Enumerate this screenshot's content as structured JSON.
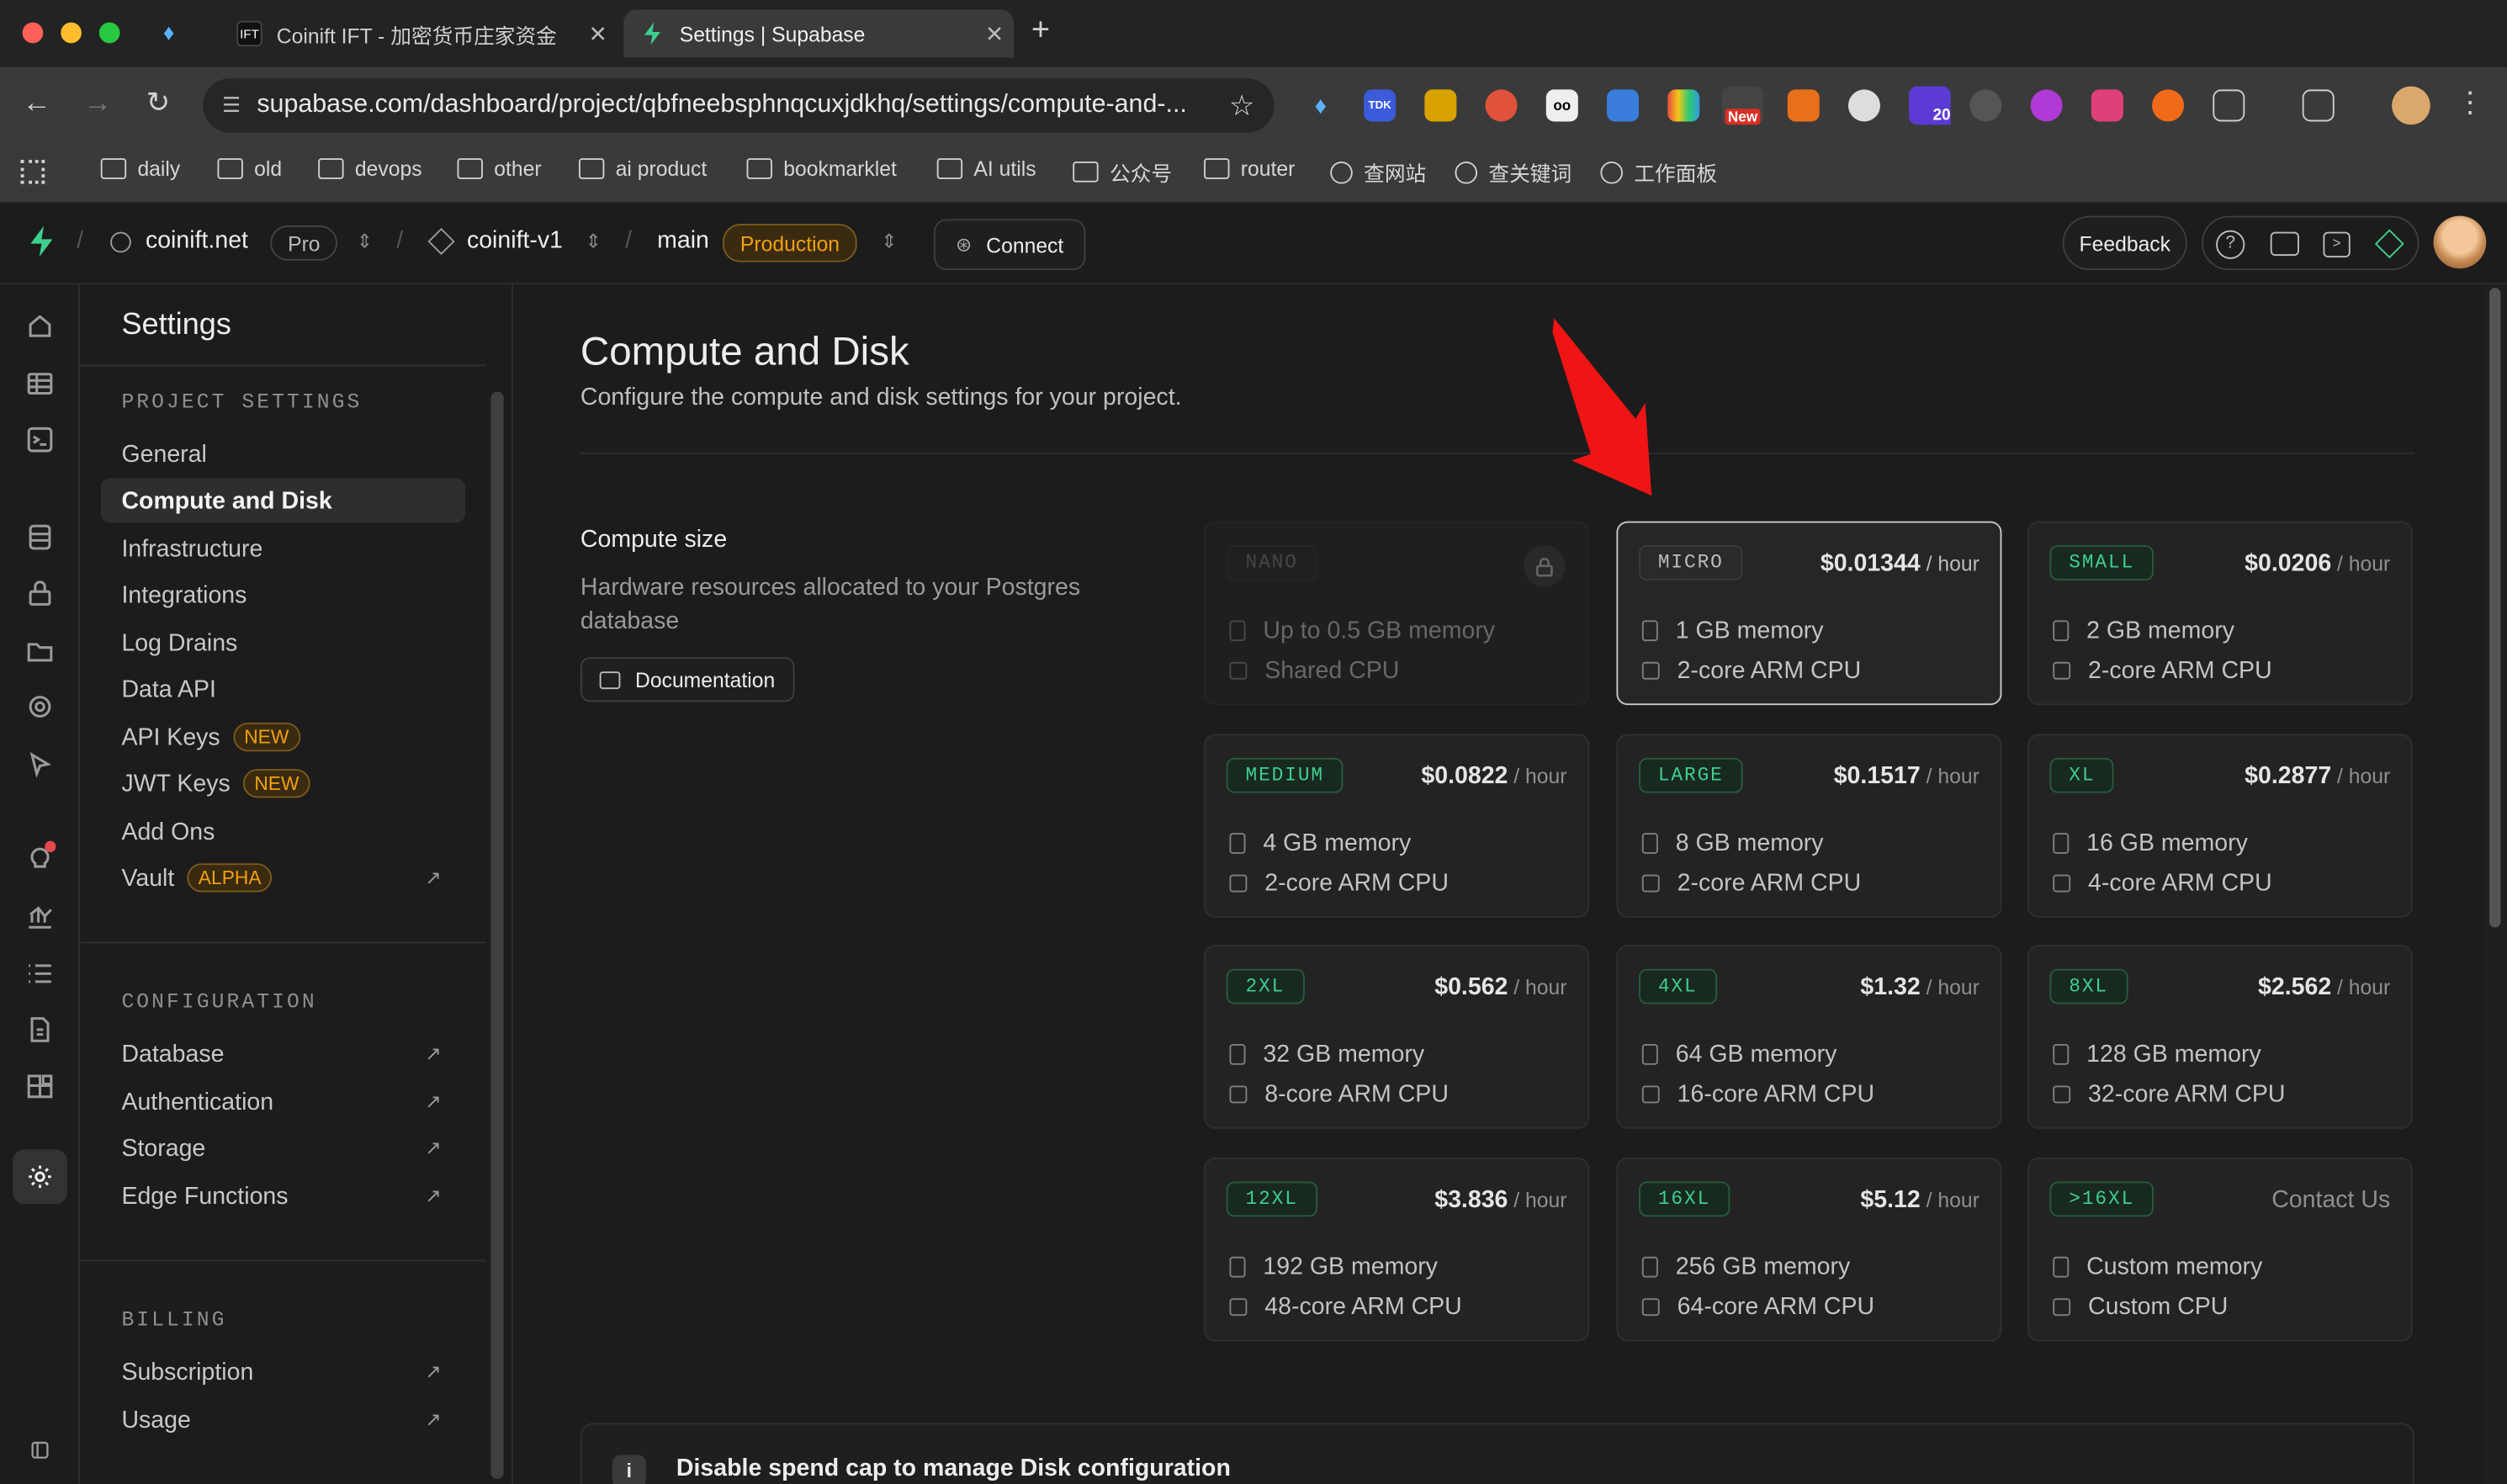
{
  "browser": {
    "tabs": [
      {
        "title": "Coinift IFT - 加密货币庄家资金",
        "favicon": "coinift"
      },
      {
        "title": "Settings | Supabase",
        "favicon": "supabase"
      }
    ],
    "url": "supabase.com/dashboard/project/qbfneebsphnqcuxjdkhq/settings/compute-and-...",
    "extension_badge_new": "New",
    "extension_badge_count": "20",
    "ext_tdk": "TDK",
    "bookmarks": [
      "daily",
      "old",
      "devops",
      "other",
      "ai product",
      "bookmarklet",
      "AI utils",
      "公众号",
      "router",
      "查网站",
      "查关键词",
      "工作面板"
    ]
  },
  "header": {
    "org": "coinift.net",
    "org_plan": "Pro",
    "project": "coinift-v1",
    "branch": "main",
    "branch_env": "Production",
    "connect_label": "Connect",
    "feedback_label": "Feedback"
  },
  "settings_menu": {
    "title": "Settings",
    "project_settings_title": "PROJECT SETTINGS",
    "project_items": [
      {
        "label": "General"
      },
      {
        "label": "Compute and Disk",
        "active": true
      },
      {
        "label": "Infrastructure"
      },
      {
        "label": "Integrations"
      },
      {
        "label": "Log Drains"
      },
      {
        "label": "Data API"
      },
      {
        "label": "API Keys",
        "tag": "NEW"
      },
      {
        "label": "JWT Keys",
        "tag": "NEW"
      },
      {
        "label": "Add Ons"
      },
      {
        "label": "Vault",
        "tag": "ALPHA",
        "external": true
      }
    ],
    "configuration_title": "CONFIGURATION",
    "configuration_items": [
      {
        "label": "Database"
      },
      {
        "label": "Authentication"
      },
      {
        "label": "Storage"
      },
      {
        "label": "Edge Functions"
      }
    ],
    "billing_title": "BILLING",
    "billing_items": [
      {
        "label": "Subscription"
      },
      {
        "label": "Usage"
      }
    ]
  },
  "page": {
    "title": "Compute and Disk",
    "subtitle": "Configure the compute and disk settings for your project.",
    "compute_title": "Compute size",
    "compute_desc_line1": "Hardware resources allocated to your Postgres",
    "compute_desc_line2": "database",
    "docs_label": "Documentation",
    "per_hour": "/ hour",
    "notice": "Disable spend cap to manage Disk configuration",
    "accent": "#3ecf8e",
    "warning": "#f1a10d"
  },
  "compute_tiers": [
    {
      "name": "NANO",
      "price": "",
      "memory": "Up to 0.5 GB memory",
      "cpu": "Shared CPU",
      "disabled": true
    },
    {
      "name": "MICRO",
      "price": "$0.01344",
      "memory": "1 GB memory",
      "cpu": "2-core ARM CPU",
      "selected": true
    },
    {
      "name": "SMALL",
      "price": "$0.0206",
      "memory": "2 GB memory",
      "cpu": "2-core ARM CPU"
    },
    {
      "name": "MEDIUM",
      "price": "$0.0822",
      "memory": "4 GB memory",
      "cpu": "2-core ARM CPU"
    },
    {
      "name": "LARGE",
      "price": "$0.1517",
      "memory": "8 GB memory",
      "cpu": "2-core ARM CPU"
    },
    {
      "name": "XL",
      "price": "$0.2877",
      "memory": "16 GB memory",
      "cpu": "4-core ARM CPU"
    },
    {
      "name": "2XL",
      "price": "$0.562",
      "memory": "32 GB memory",
      "cpu": "8-core ARM CPU"
    },
    {
      "name": "4XL",
      "price": "$1.32",
      "memory": "64 GB memory",
      "cpu": "16-core ARM CPU"
    },
    {
      "name": "8XL",
      "price": "$2.562",
      "memory": "128 GB memory",
      "cpu": "32-core ARM CPU"
    },
    {
      "name": "12XL",
      "price": "$3.836",
      "memory": "192 GB memory",
      "cpu": "48-core ARM CPU"
    },
    {
      "name": "16XL",
      "price": "$5.12",
      "memory": "256 GB memory",
      "cpu": "64-core ARM CPU"
    },
    {
      "name": ">16XL",
      "price": "Contact Us",
      "memory": "Custom memory",
      "cpu": "Custom CPU"
    }
  ]
}
